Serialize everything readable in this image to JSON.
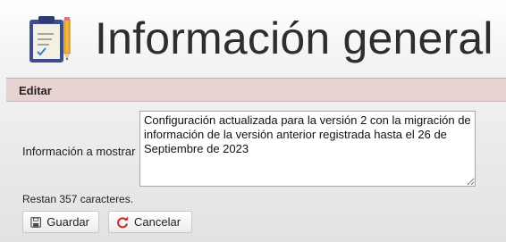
{
  "header": {
    "title": "Información general",
    "icon": "clipboard-pencil-icon"
  },
  "panel": {
    "title": "Editar",
    "field": {
      "label": "Información a mostrar",
      "value": "Configuración actualizada para la versión 2 con la migración de información de la versión anterior registrada hasta el 26 de Septiembre de 2023"
    },
    "counter": "Restan 357 caracteres."
  },
  "buttons": {
    "save": {
      "label": "Guardar",
      "icon": "floppy-disk-icon"
    },
    "cancel": {
      "label": "Cancelar",
      "icon": "refresh-icon"
    }
  },
  "colors": {
    "panel_header_bg": "#e9d2d2",
    "cancel_icon": "#c62828",
    "title_text": "#2e2e2e"
  }
}
